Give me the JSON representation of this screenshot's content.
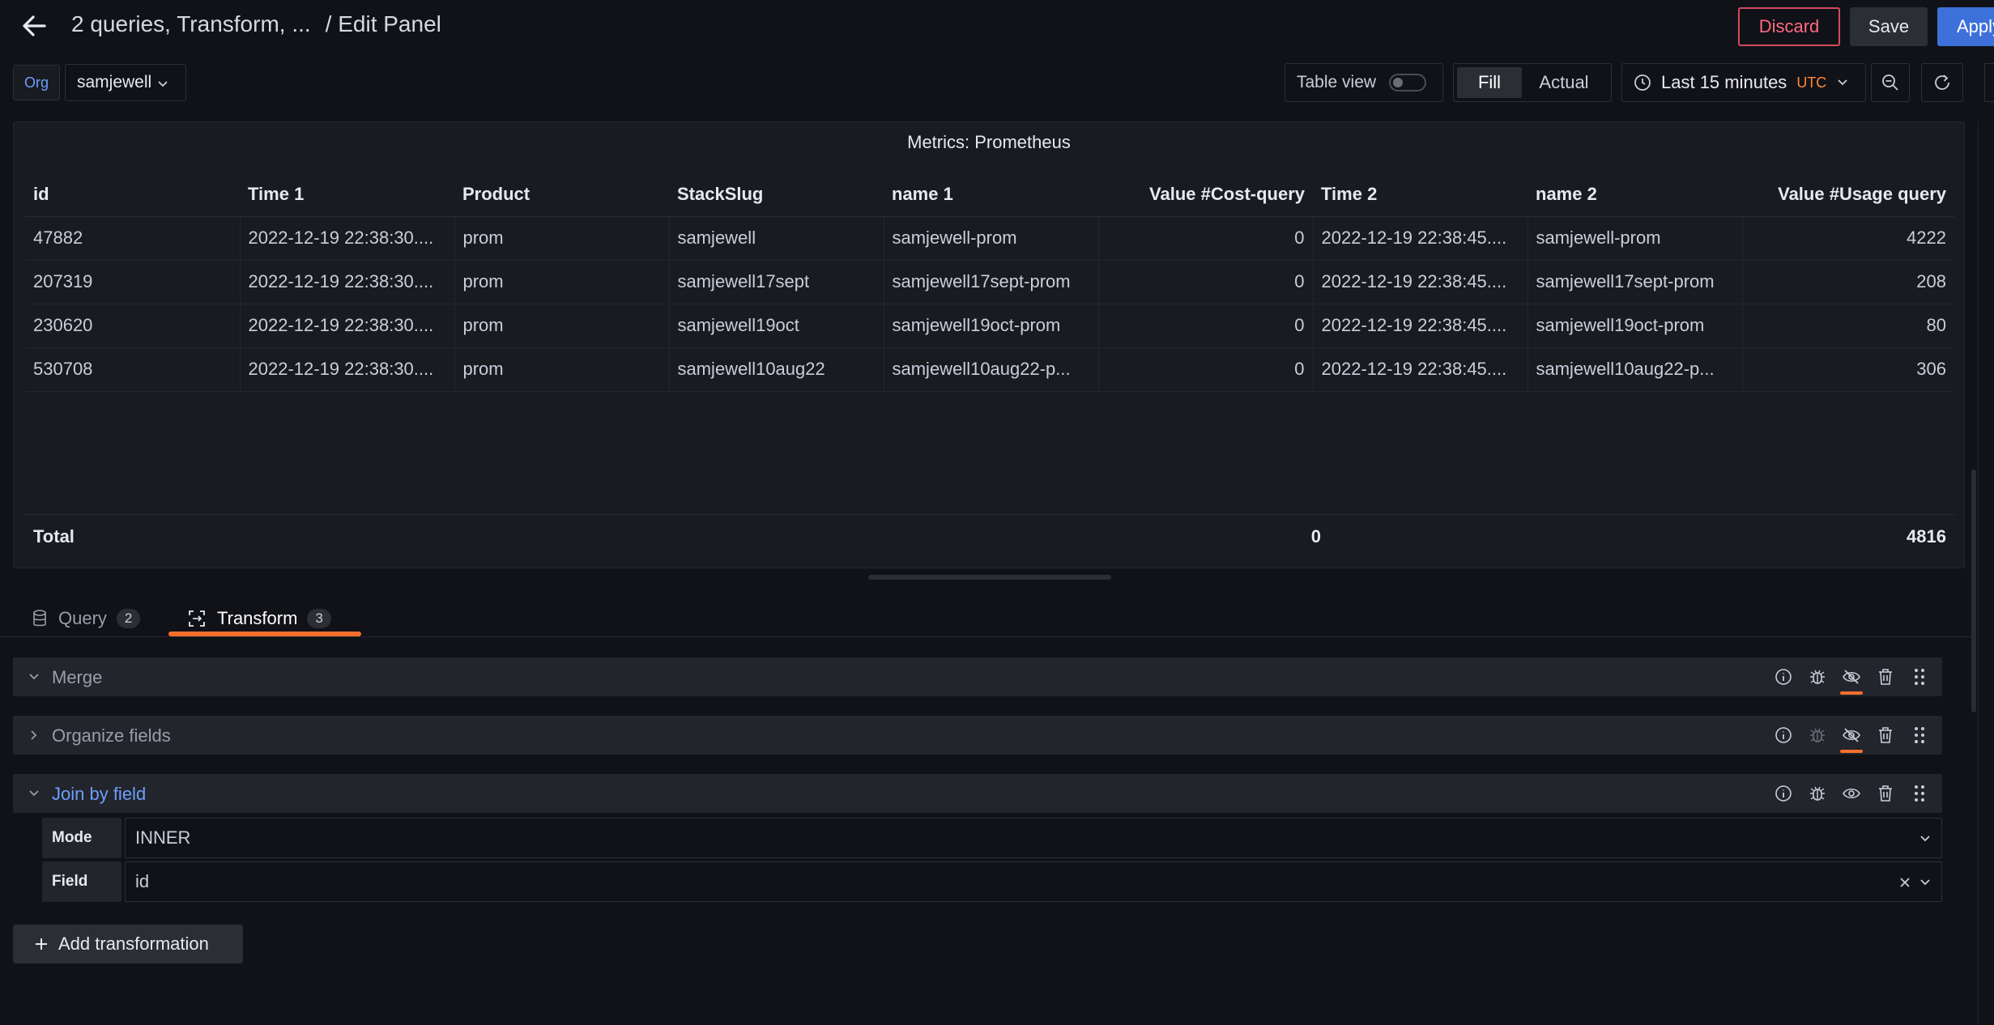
{
  "header": {
    "title": "2 queries, Transform, ...",
    "subtitle": "/ Edit Panel",
    "discard_label": "Discard",
    "save_label": "Save",
    "apply_label": "Apply"
  },
  "toolbar": {
    "org_badge": "Org",
    "org_name": "samjewell",
    "table_view_label": "Table view",
    "table_view_enabled": false,
    "fill_label": "Fill",
    "actual_label": "Actual",
    "time_range": "Last 15 minutes",
    "timezone": "UTC"
  },
  "panel": {
    "title": "Metrics: Prometheus",
    "columns": [
      "id",
      "Time 1",
      "Product",
      "StackSlug",
      "name 1",
      "Value #Cost-query",
      "Time 2",
      "name 2",
      "Value #Usage query"
    ],
    "rows": [
      [
        "47882",
        "2022-12-19 22:38:30....",
        "prom",
        "samjewell",
        "samjewell-prom",
        "0",
        "2022-12-19 22:38:45....",
        "samjewell-prom",
        "4222"
      ],
      [
        "207319",
        "2022-12-19 22:38:30....",
        "prom",
        "samjewell17sept",
        "samjewell17sept-prom",
        "0",
        "2022-12-19 22:38:45....",
        "samjewell17sept-prom",
        "208"
      ],
      [
        "230620",
        "2022-12-19 22:38:30....",
        "prom",
        "samjewell19oct",
        "samjewell19oct-prom",
        "0",
        "2022-12-19 22:38:45....",
        "samjewell19oct-prom",
        "80"
      ],
      [
        "530708",
        "2022-12-19 22:38:30....",
        "prom",
        "samjewell10aug22",
        "samjewell10aug22-p...",
        "0",
        "2022-12-19 22:38:45....",
        "samjewell10aug22-p...",
        "306"
      ]
    ],
    "total_label": "Total",
    "total_cost": "0",
    "total_usage": "4816"
  },
  "tabs": [
    {
      "label": "Query",
      "count": "2",
      "active": false
    },
    {
      "label": "Transform",
      "count": "3",
      "active": true
    }
  ],
  "transformations": [
    {
      "name": "Merge",
      "expanded": true,
      "disabled": true
    },
    {
      "name": "Organize fields",
      "expanded": false,
      "disabled": true
    },
    {
      "name": "Join by field",
      "expanded": true,
      "disabled": false
    }
  ],
  "join": {
    "mode_label": "Mode",
    "mode_value": "INNER",
    "field_label": "Field",
    "field_value": "id"
  },
  "add_transformation_label": "Add transformation",
  "colors": {
    "accent_blue": "#6e9fff",
    "accent_orange": "#f46f2d",
    "danger": "#ff6a80",
    "primary": "#3d71d9",
    "background": "#111217"
  }
}
